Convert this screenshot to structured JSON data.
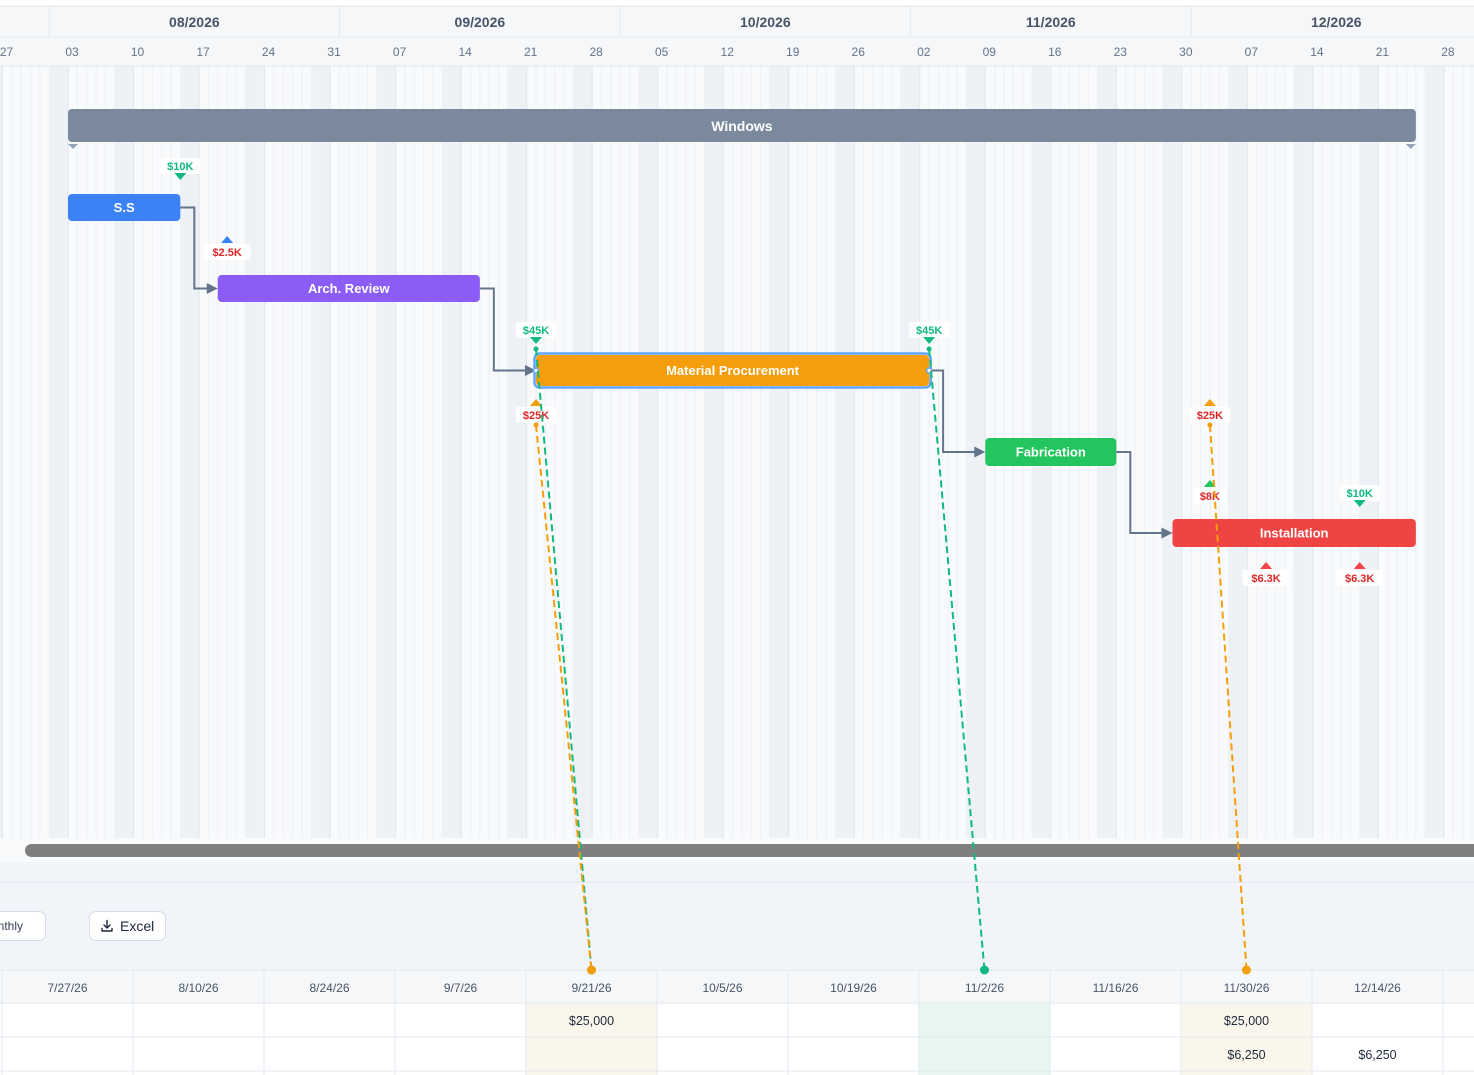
{
  "months": [
    "08/2026",
    "09/2026",
    "10/2026",
    "11/2026",
    "12/2026"
  ],
  "weeks": [
    "27",
    "03",
    "10",
    "17",
    "24",
    "31",
    "07",
    "14",
    "21",
    "28",
    "05",
    "12",
    "19",
    "26",
    "02",
    "09",
    "16",
    "23",
    "30",
    "07",
    "14",
    "21",
    "28"
  ],
  "group": {
    "label": "Windows",
    "color": "#7a8a9c"
  },
  "tasks": [
    {
      "label": "S.S",
      "color": "#3b82f6",
      "selected": false
    },
    {
      "label": "Arch. Review",
      "color": "#8b5cf6",
      "selected": false
    },
    {
      "label": "Material Procurement",
      "color": "#f59e0b",
      "selected": true
    },
    {
      "label": "Fabrication",
      "color": "#22c55e",
      "selected": false
    },
    {
      "label": "Installation",
      "color": "#ef4444",
      "selected": false
    }
  ],
  "cash_markers": [
    {
      "label": "$10K",
      "kind": "income",
      "color": "#10b981"
    },
    {
      "label": "$2.5K",
      "kind": "expense",
      "color": "#dc2626",
      "arrow_color": "#3b82f6"
    },
    {
      "label": "$45K",
      "kind": "income",
      "color": "#10b981"
    },
    {
      "label": "$45K",
      "kind": "income",
      "color": "#10b981"
    },
    {
      "label": "$25K",
      "kind": "expense",
      "color": "#dc2626",
      "arrow_color": "#f59e0b"
    },
    {
      "label": "$25K",
      "kind": "expense",
      "color": "#dc2626",
      "arrow_color": "#f59e0b"
    },
    {
      "label": "$8K",
      "kind": "expense",
      "color": "#dc2626",
      "arrow_color": "#22c55e"
    },
    {
      "label": "$10K",
      "kind": "income",
      "color": "#10b981"
    },
    {
      "label": "$6.3K",
      "kind": "expense",
      "color": "#dc2626",
      "arrow_color": "#ef4444"
    },
    {
      "label": "$6.3K",
      "kind": "expense",
      "color": "#dc2626",
      "arrow_color": "#ef4444"
    }
  ],
  "toolbar": {
    "monthly_label": "onthly",
    "excel_label": "Excel"
  },
  "cashflow_table": {
    "columns": [
      "7/27/26",
      "8/10/26",
      "8/24/26",
      "9/7/26",
      "9/21/26",
      "10/5/26",
      "10/19/26",
      "11/2/26",
      "11/16/26",
      "11/30/26",
      "12/14/26"
    ],
    "rows": [
      [
        "",
        "",
        "",
        "",
        "$25,000",
        "",
        "",
        "",
        "",
        "$25,000",
        ""
      ],
      [
        "",
        "",
        "",
        "",
        "",
        "",
        "",
        "",
        "",
        "$6,250",
        "$6,250"
      ]
    ]
  },
  "colors": {
    "income": "#10b981",
    "expense_link": "#f59e0b",
    "dependency": "#64748b",
    "selection": "#60a5fa"
  }
}
